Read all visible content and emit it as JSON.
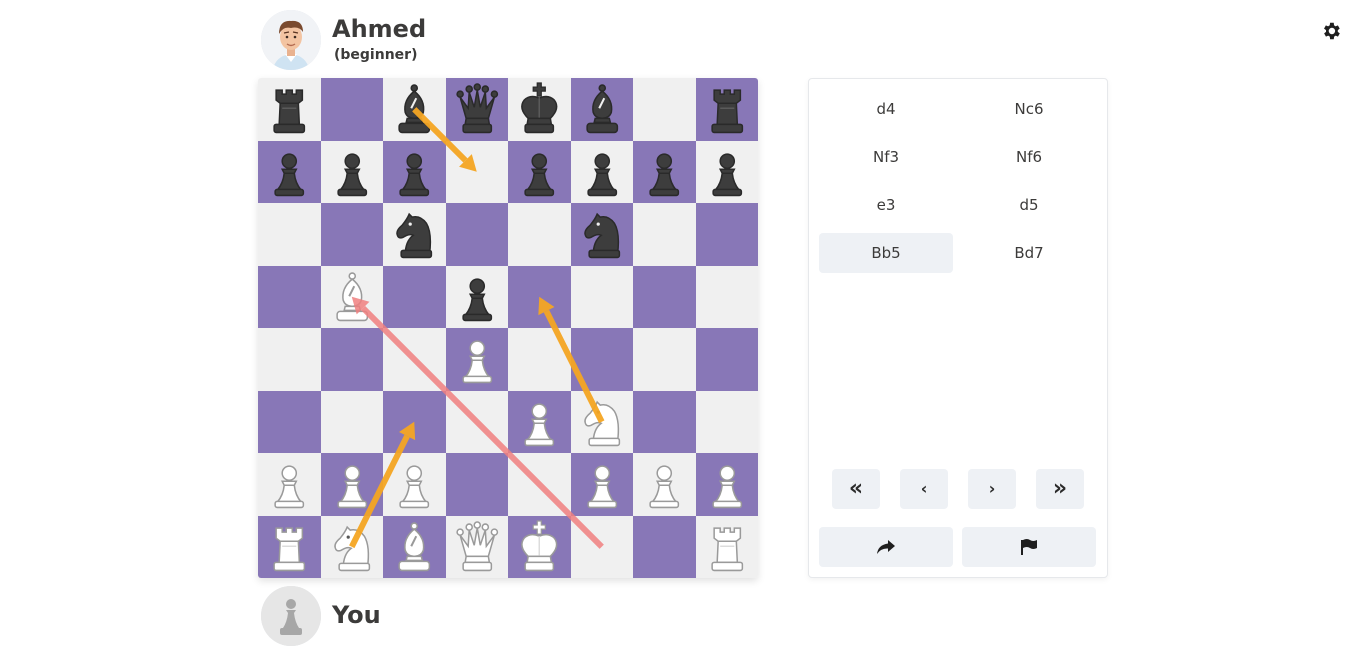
{
  "opponent": {
    "name": "Ahmed",
    "level": "(beginner)"
  },
  "you": {
    "name": "You"
  },
  "colors": {
    "light_square": "#f0f0f0",
    "dark_square": "#8877b7",
    "arrow_orange": "#f5a623",
    "arrow_red": "#f08080"
  },
  "board": {
    "orientation": "white-bottom",
    "pieces": [
      {
        "sq": "a8",
        "p": "bR"
      },
      {
        "sq": "c8",
        "p": "bB"
      },
      {
        "sq": "d8",
        "p": "bQ"
      },
      {
        "sq": "e8",
        "p": "bK"
      },
      {
        "sq": "f8",
        "p": "bB"
      },
      {
        "sq": "h8",
        "p": "bR"
      },
      {
        "sq": "a7",
        "p": "bP"
      },
      {
        "sq": "b7",
        "p": "bP"
      },
      {
        "sq": "c7",
        "p": "bP"
      },
      {
        "sq": "e7",
        "p": "bP"
      },
      {
        "sq": "f7",
        "p": "bP"
      },
      {
        "sq": "g7",
        "p": "bP"
      },
      {
        "sq": "h7",
        "p": "bP"
      },
      {
        "sq": "c6",
        "p": "bN"
      },
      {
        "sq": "f6",
        "p": "bN"
      },
      {
        "sq": "b5",
        "p": "wB"
      },
      {
        "sq": "d5",
        "p": "bP"
      },
      {
        "sq": "d4",
        "p": "wP"
      },
      {
        "sq": "e3",
        "p": "wP"
      },
      {
        "sq": "f3",
        "p": "wN"
      },
      {
        "sq": "a2",
        "p": "wP"
      },
      {
        "sq": "b2",
        "p": "wP"
      },
      {
        "sq": "c2",
        "p": "wP"
      },
      {
        "sq": "f2",
        "p": "wP"
      },
      {
        "sq": "g2",
        "p": "wP"
      },
      {
        "sq": "h2",
        "p": "wP"
      },
      {
        "sq": "a1",
        "p": "wR"
      },
      {
        "sq": "b1",
        "p": "wN"
      },
      {
        "sq": "c1",
        "p": "wB"
      },
      {
        "sq": "d1",
        "p": "wQ"
      },
      {
        "sq": "e1",
        "p": "wK"
      },
      {
        "sq": "h1",
        "p": "wR"
      }
    ],
    "arrows": [
      {
        "from": "c8",
        "to": "d7",
        "color": "orange"
      },
      {
        "from": "f3",
        "to": "e5",
        "color": "orange"
      },
      {
        "from": "b1",
        "to": "c3",
        "color": "orange"
      },
      {
        "from": "f1",
        "to": "b5",
        "color": "red"
      }
    ]
  },
  "moves": [
    {
      "white": "d4",
      "black": "Nc6"
    },
    {
      "white": "Nf3",
      "black": "Nf6"
    },
    {
      "white": "e3",
      "black": "d5"
    },
    {
      "white": "Bb5",
      "black": "Bd7"
    }
  ],
  "active_move": "Bb5",
  "nav": {
    "first_icon": "double-chevron-left-icon",
    "prev_icon": "chevron-left-icon",
    "next_icon": "chevron-right-icon",
    "last_icon": "double-chevron-right-icon",
    "first_glyph": "«",
    "prev_glyph": "‹",
    "next_glyph": "›",
    "last_glyph": "»"
  },
  "actions": {
    "share_icon": "share-arrow-icon",
    "resign_icon": "flag-icon"
  },
  "settings_icon": "gear-icon"
}
